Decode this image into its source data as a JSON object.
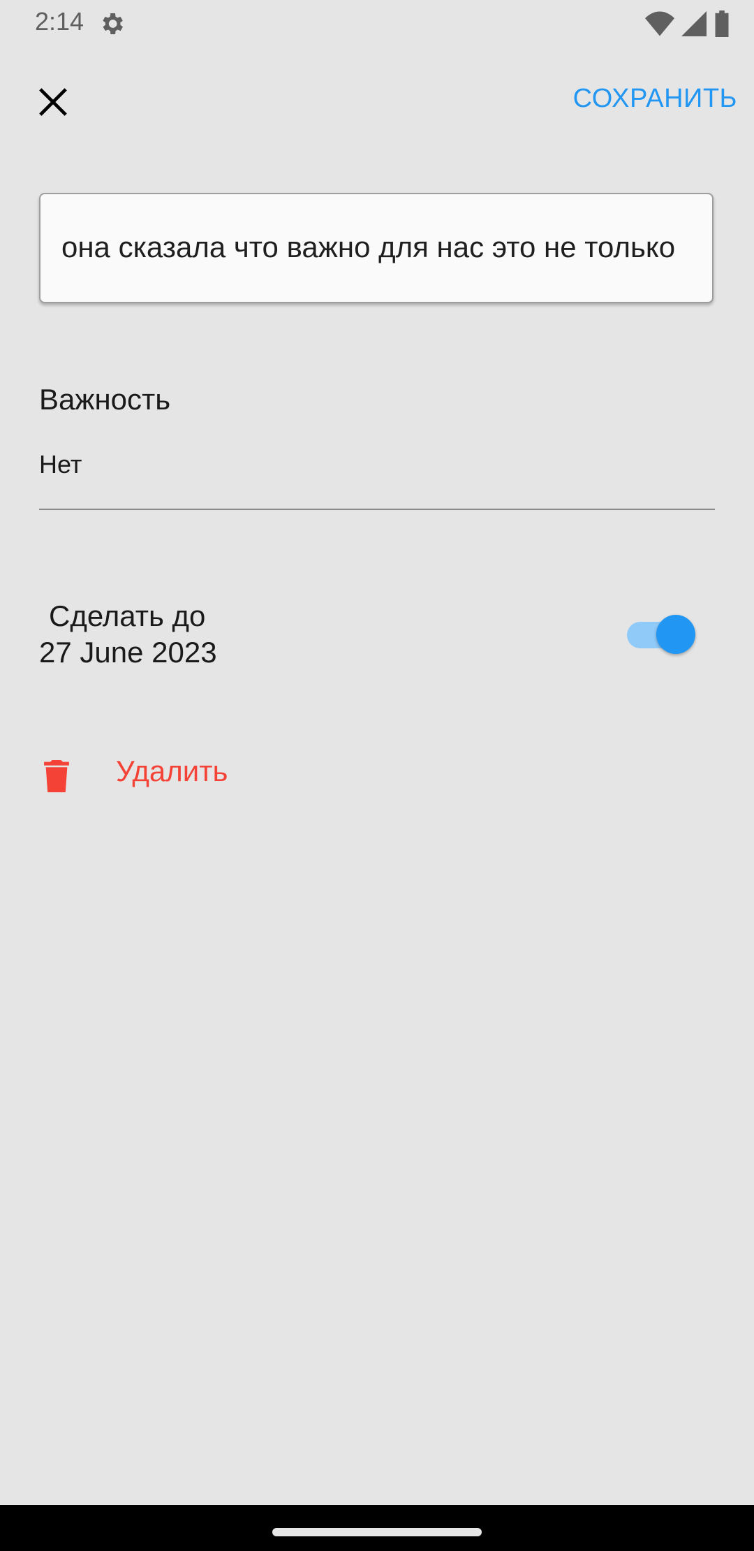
{
  "status_bar": {
    "time": "2:14",
    "icons": [
      "gear-icon",
      "wifi-icon",
      "signal-icon",
      "battery-icon"
    ]
  },
  "toolbar": {
    "close_icon": "close-icon",
    "save_label": "СОХРАНИТЬ"
  },
  "task": {
    "text": "она сказала что важно для нас это не только"
  },
  "importance": {
    "label": "Важность",
    "value": "Нет"
  },
  "deadline": {
    "title": "Сделать до",
    "date": "27 June 2023",
    "enabled": true
  },
  "delete": {
    "icon": "trash-icon",
    "label": "Удалить"
  },
  "colors": {
    "background": "#e5e5e5",
    "accent": "#2196f3",
    "accent_light": "#90caf9",
    "danger": "#f44336"
  }
}
